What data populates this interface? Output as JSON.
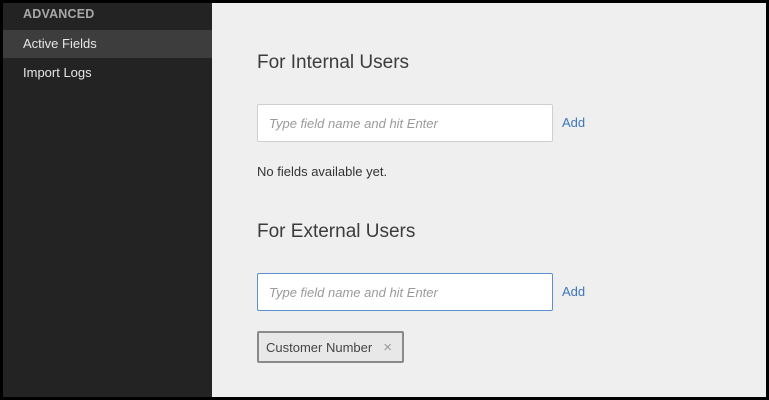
{
  "sidebar": {
    "section_title": "ADVANCED",
    "items": [
      {
        "label": "Active Fields",
        "active": true
      },
      {
        "label": "Import Logs",
        "active": false
      }
    ]
  },
  "internal": {
    "heading": "For Internal Users",
    "input_placeholder": "Type field name and hit Enter",
    "input_value": "",
    "add_label": "Add",
    "empty_message": "No fields available yet."
  },
  "external": {
    "heading": "For External Users",
    "input_placeholder": "Type field name and hit Enter",
    "input_value": "",
    "add_label": "Add",
    "tags": [
      {
        "label": "Customer Number",
        "remove_glyph": "×",
        "remove_icon": "close-icon"
      }
    ]
  },
  "colors": {
    "sidebar_bg": "#232323",
    "sidebar_active": "#3d3d3d",
    "main_bg": "#efefef",
    "link": "#3e76bd",
    "focus_border": "#5b8fd0"
  }
}
